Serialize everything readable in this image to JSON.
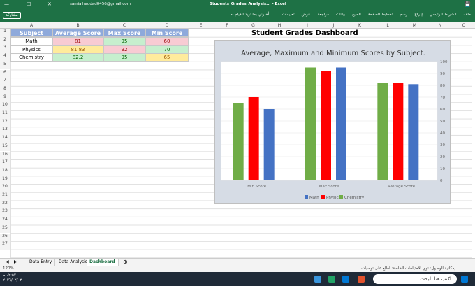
{
  "titlebar": {
    "user": "samialhaddad0456@gmail.com",
    "filename": "Students_Grades_Analysis... - Excel"
  },
  "ribbon": {
    "share": "مشاركة",
    "tell": "أخبرني بما تريد القيام به",
    "tabs": [
      "ملف",
      "الشريط الرئيسي",
      "إدراج",
      "رسم",
      "تخطيط الصفحة",
      "الصيغ",
      "بيانات",
      "مراجعة",
      "عرض",
      "تعليمات"
    ]
  },
  "columns": [
    "A",
    "B",
    "C",
    "D",
    "E",
    "F",
    "G",
    "H",
    "I",
    "J",
    "K",
    "L",
    "M",
    "N",
    "O"
  ],
  "rows": [
    "1",
    "2",
    "3",
    "4",
    "5",
    "6",
    "7",
    "8",
    "9",
    "10",
    "11",
    "12",
    "13",
    "14",
    "15",
    "16",
    "17",
    "18",
    "19",
    "20",
    "21",
    "22",
    "23",
    "24",
    "25",
    "26",
    "27"
  ],
  "table": {
    "headers": [
      "Subject",
      "Average Score",
      "Max Score",
      "Min Score"
    ],
    "rows": [
      [
        "Math",
        "81",
        "95",
        "60"
      ],
      [
        "Physics",
        "81.83",
        "92",
        "70"
      ],
      [
        "Chemistry",
        "82.2",
        "95",
        "65"
      ]
    ]
  },
  "dashboard_title": "Student Grades Dashboard",
  "chart_data": {
    "type": "bar",
    "title": "Average, Maximum and  Minimum Scores by Subject.",
    "categories": [
      "Min Score",
      "Max Score",
      "Average Score"
    ],
    "series": [
      {
        "name": "Math",
        "color": "#4472c4",
        "values": [
          60,
          95,
          81
        ]
      },
      {
        "name": "Physics",
        "color": "#ff0000",
        "values": [
          70,
          92,
          81.83
        ]
      },
      {
        "name": "Chemistry",
        "color": "#70ad47",
        "values": [
          65,
          95,
          82.2
        ]
      }
    ],
    "ylim": [
      0,
      100
    ],
    "yticks": [
      "0",
      "10",
      "20",
      "30",
      "40",
      "50",
      "60",
      "70",
      "80",
      "90",
      "100"
    ],
    "legend": "bottom"
  },
  "sheets": [
    "Data Entry",
    "Data Analysis",
    "Dashboard"
  ],
  "status": {
    "zoom": "120%",
    "accessibility": "إمكانية الوصول: توي الاحتياجات الخاصة: اطلع على توصيات"
  },
  "taskbar": {
    "search": "اكتب هنا للبحث",
    "time": "٠٢:٥٧ م",
    "date": "٢٠٢٦/٠٢/٠٢"
  }
}
